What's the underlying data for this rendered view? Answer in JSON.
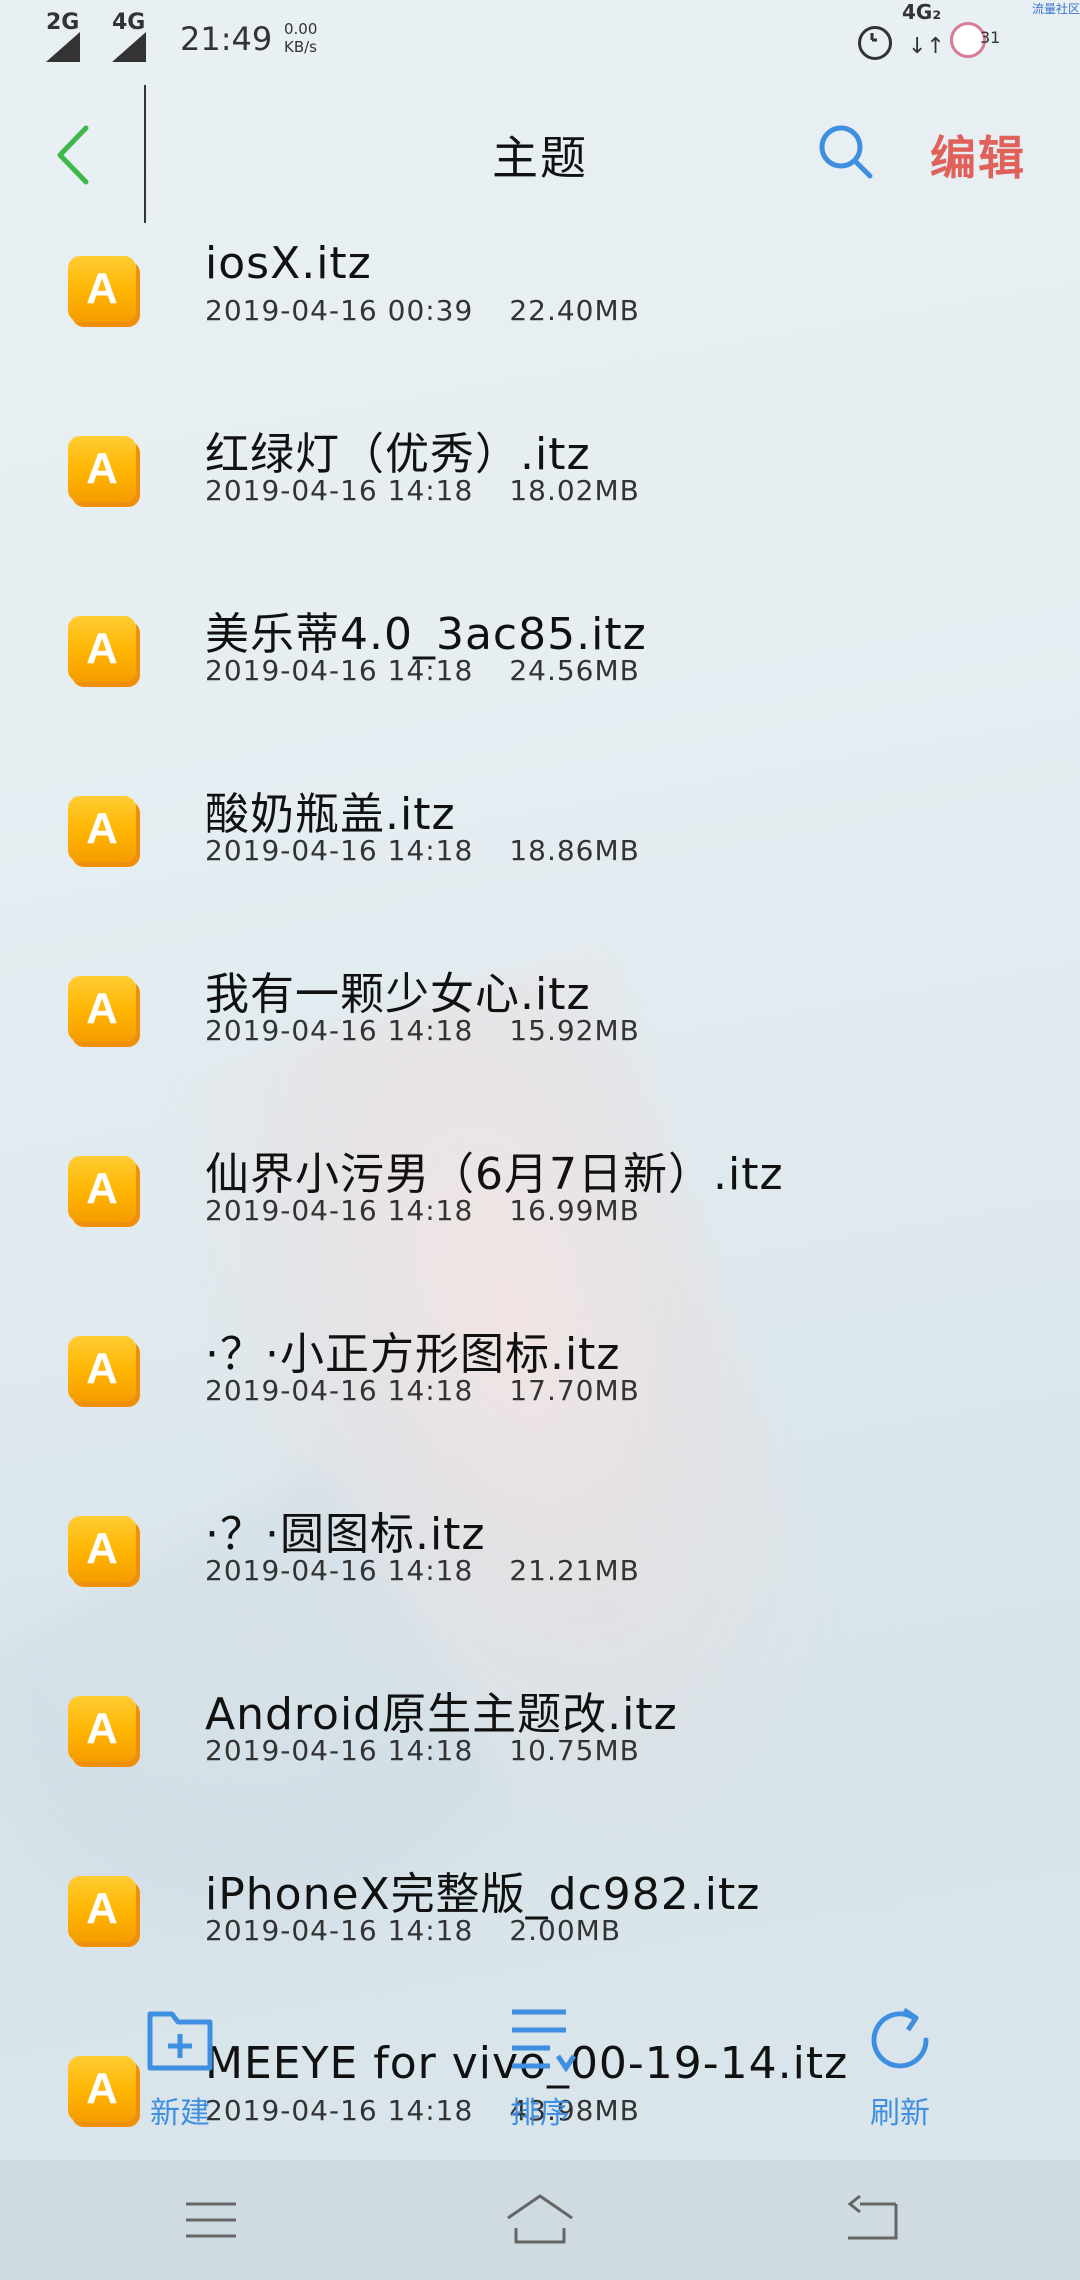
{
  "status_bar": {
    "sim1": "2G",
    "sim2": "4G",
    "time": "21:49",
    "speed_value": "0.00",
    "speed_unit": "KB/s",
    "net_type": "4G₂",
    "battery": "31",
    "corner_text": "流量社区"
  },
  "header": {
    "title": "主题",
    "edit_label": "编辑"
  },
  "files": [
    {
      "name": "iosX.itz",
      "date": "2019-04-16 00:39",
      "size": "22.40MB"
    },
    {
      "name": "红绿灯（优秀）.itz",
      "date": "2019-04-16 14:18",
      "size": "18.02MB"
    },
    {
      "name": "美乐蒂4.0_3ac85.itz",
      "date": "2019-04-16 14:18",
      "size": "24.56MB"
    },
    {
      "name": "酸奶瓶盖.itz",
      "date": "2019-04-16 14:18",
      "size": "18.86MB"
    },
    {
      "name": "我有一颗少女心.itz",
      "date": "2019-04-16 14:18",
      "size": "15.92MB"
    },
    {
      "name": "仙界小污男（6月7日新）.itz",
      "date": "2019-04-16 14:18",
      "size": "16.99MB"
    },
    {
      "name": "·？·小正方形图标.itz",
      "date": "2019-04-16 14:18",
      "size": "17.70MB"
    },
    {
      "name": "·？·圆图标.itz",
      "date": "2019-04-16 14:18",
      "size": "21.21MB"
    },
    {
      "name": "Android原生主题改.itz",
      "date": "2019-04-16 14:18",
      "size": "10.75MB"
    },
    {
      "name": "iPhoneX完整版_dc982.itz",
      "date": "2019-04-16 14:18",
      "size": "2.00MB"
    },
    {
      "name": "MEEYE for vivo_00-19-14.itz",
      "date": "2019-04-16 14:18",
      "size": "43.98MB"
    }
  ],
  "file_icon_letter": "A",
  "actions": {
    "new_label": "新建",
    "sort_label": "排序",
    "refresh_label": "刷新"
  },
  "colors": {
    "accent_blue": "#3f8fe0",
    "edit_red": "#e0605a",
    "back_green": "#3db84a",
    "icon_orange": "#ffb400"
  },
  "icons": {
    "back": "chevron-left-icon",
    "search": "search-icon",
    "new": "new-folder-icon",
    "sort": "sort-icon",
    "refresh": "refresh-icon",
    "menu": "menu-icon",
    "home": "home-icon",
    "return": "return-icon"
  }
}
